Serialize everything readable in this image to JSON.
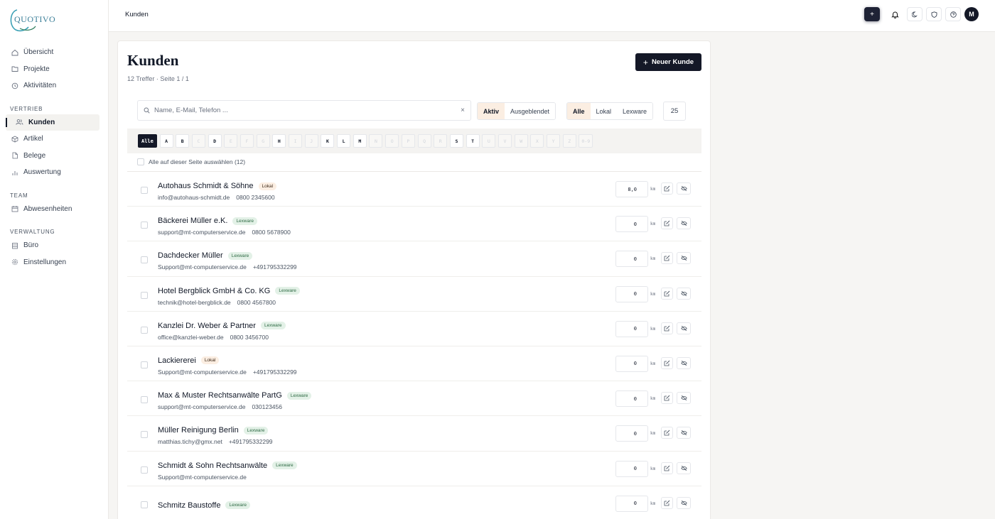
{
  "brand": {
    "logo_text": "QUOTIVO"
  },
  "breadcrumb": "Kunden",
  "sidebar": {
    "items_top": [
      {
        "label": "Übersicht",
        "icon": "home-icon"
      },
      {
        "label": "Projekte",
        "icon": "folder-icon"
      },
      {
        "label": "Aktivitäten",
        "icon": "clock-icon"
      }
    ],
    "section_vertrieb": "VERTRIEB",
    "items_vertrieb": [
      {
        "label": "Kunden",
        "icon": "users-icon",
        "active": true
      },
      {
        "label": "Artikel",
        "icon": "box-icon"
      },
      {
        "label": "Belege",
        "icon": "file-icon"
      },
      {
        "label": "Auswertung",
        "icon": "bar-chart-icon"
      }
    ],
    "section_team": "TEAM",
    "items_team": [
      {
        "label": "Abwesenheiten",
        "icon": "calendar-icon"
      }
    ],
    "section_verwaltung": "VERWALTUNG",
    "items_verwaltung": [
      {
        "label": "Büro",
        "icon": "building-icon"
      },
      {
        "label": "Einstellungen",
        "icon": "gear-icon"
      }
    ]
  },
  "topbar": {
    "avatar_initial": "M"
  },
  "page": {
    "title": "Kunden",
    "subtitle": "12 Treffer · Seite 1 / 1",
    "new_button": "Neuer Kunde"
  },
  "search": {
    "placeholder": "Name, E-Mail, Telefon ..."
  },
  "filters": {
    "status": [
      "Aktiv",
      "Ausgeblendet"
    ],
    "status_selected": "Aktiv",
    "source": [
      "Alle",
      "Lokal",
      "Lexware"
    ],
    "source_selected": "Alle",
    "per_page": "25"
  },
  "letters": [
    {
      "l": "Alle",
      "state": "sel"
    },
    {
      "l": "A",
      "state": "en"
    },
    {
      "l": "B",
      "state": "en"
    },
    {
      "l": "C",
      "state": "dis"
    },
    {
      "l": "D",
      "state": "en"
    },
    {
      "l": "E",
      "state": "dis"
    },
    {
      "l": "F",
      "state": "dis"
    },
    {
      "l": "G",
      "state": "dis"
    },
    {
      "l": "H",
      "state": "en"
    },
    {
      "l": "I",
      "state": "dis"
    },
    {
      "l": "J",
      "state": "dis"
    },
    {
      "l": "K",
      "state": "en"
    },
    {
      "l": "L",
      "state": "en"
    },
    {
      "l": "M",
      "state": "en"
    },
    {
      "l": "N",
      "state": "dis"
    },
    {
      "l": "O",
      "state": "dis"
    },
    {
      "l": "P",
      "state": "dis"
    },
    {
      "l": "Q",
      "state": "dis"
    },
    {
      "l": "R",
      "state": "dis"
    },
    {
      "l": "S",
      "state": "en"
    },
    {
      "l": "T",
      "state": "en"
    },
    {
      "l": "U",
      "state": "dis"
    },
    {
      "l": "V",
      "state": "dis"
    },
    {
      "l": "W",
      "state": "dis"
    },
    {
      "l": "X",
      "state": "dis"
    },
    {
      "l": "Y",
      "state": "dis"
    },
    {
      "l": "Z",
      "state": "dis"
    },
    {
      "l": "0-9",
      "state": "dis"
    }
  ],
  "select_all_label": "Alle auf dieser Seite auswählen (12)",
  "km_unit": "km",
  "customers": [
    {
      "name": "Autohaus Schmidt & Söhne",
      "source": "Lokal",
      "email": "info@autohaus-schmidt.de",
      "phone": "0800 2345600",
      "km": "8,0"
    },
    {
      "name": "Bäckerei Müller e.K.",
      "source": "Lexware",
      "email": "support@mt-computerservice.de",
      "phone": "0800 5678900",
      "km": "0"
    },
    {
      "name": "Dachdecker Müller",
      "source": "Lexware",
      "email": "Support@mt-computerservice.de",
      "phone": "+491795332299",
      "km": "0"
    },
    {
      "name": "Hotel Bergblick GmbH & Co. KG",
      "source": "Lexware",
      "email": "technik@hotel-bergblick.de",
      "phone": "0800 4567800",
      "km": "0"
    },
    {
      "name": "Kanzlei Dr. Weber & Partner",
      "source": "Lexware",
      "email": "office@kanzlei-weber.de",
      "phone": "0800 3456700",
      "km": "0"
    },
    {
      "name": "Lackiererei",
      "source": "Lokal",
      "email": "Support@mt-computerservice.de",
      "phone": "+491795332299",
      "km": "0"
    },
    {
      "name": "Max & Muster Rechtsanwälte PartG",
      "source": "Lexware",
      "email": "support@mt-computerservice.de",
      "phone": "030123456",
      "km": "0"
    },
    {
      "name": "Müller Reinigung Berlin",
      "source": "Lexware",
      "email": "matthias.tichy@gmx.net",
      "phone": "+491795332299",
      "km": "0"
    },
    {
      "name": "Schmidt & Sohn Rechtsanwälte",
      "source": "Lexware",
      "email": "Support@mt-computerservice.de",
      "phone": "",
      "km": "0"
    },
    {
      "name": "Schmitz Baustoffe",
      "source": "Lexware",
      "email": "",
      "phone": "",
      "km": "0"
    }
  ]
}
